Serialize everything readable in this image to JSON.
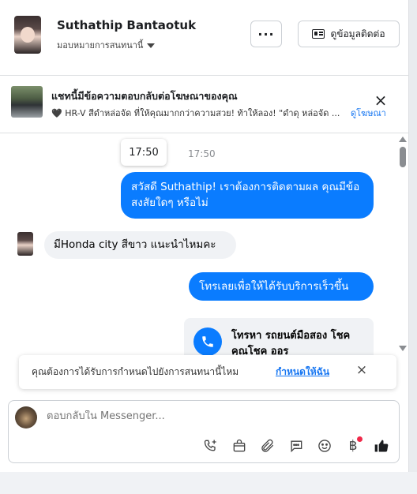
{
  "header": {
    "name": "Suthathip Bantaotuk",
    "assign_label": "มอบหมายการสนทนานี้",
    "more_label": "···",
    "contact_button": "ดูข้อมูลติดต่อ"
  },
  "ad": {
    "title": "แชทนี้มีข้อความตอบกลับต่อโฆษณาของคุณ",
    "description": "🖤 HR-V สีดำหล่อจัด ที่ให้คุณมากกว่าความสวย! ท้าให้ลอง! \"ดำดุ หล่อจัด ...",
    "link": "ดูโฆษณา",
    "close": "×"
  },
  "messages": {
    "time_tooltip": "17:50",
    "timestamp": "17:50",
    "outgoing_1": "สวัสดี Suthathip! เราต้องการติดตามผล คุณมีข้อสงสัยใดๆ หรือไม่",
    "incoming_1": "มีHonda city สีขาว แนะนำไหมคะ",
    "outgoing_2": "โทรเลยเพื่อให้ได้รับบริการเร็วขึ้น",
    "call_card_text": "โทรหา รถยนต์มือสอง โชคคุณโชค ออร"
  },
  "prompt": {
    "text": "คุณต้องการได้รับการกำหนดไปยังการสนทนานี้ไหม",
    "link": "กำหนดให้ฉัน",
    "close": "×"
  },
  "composer": {
    "placeholder": "ตอบกลับใน Messenger...",
    "tools": [
      "phone-plus-icon",
      "shopping-bag-icon",
      "paperclip-icon",
      "saved-replies-icon",
      "emoji-icon",
      "baht-icon",
      "thumbs-up-icon"
    ],
    "baht_symbol": "฿"
  },
  "colors": {
    "accent": "#0a7cff",
    "link": "#1877f2",
    "notification": "#f02849"
  }
}
